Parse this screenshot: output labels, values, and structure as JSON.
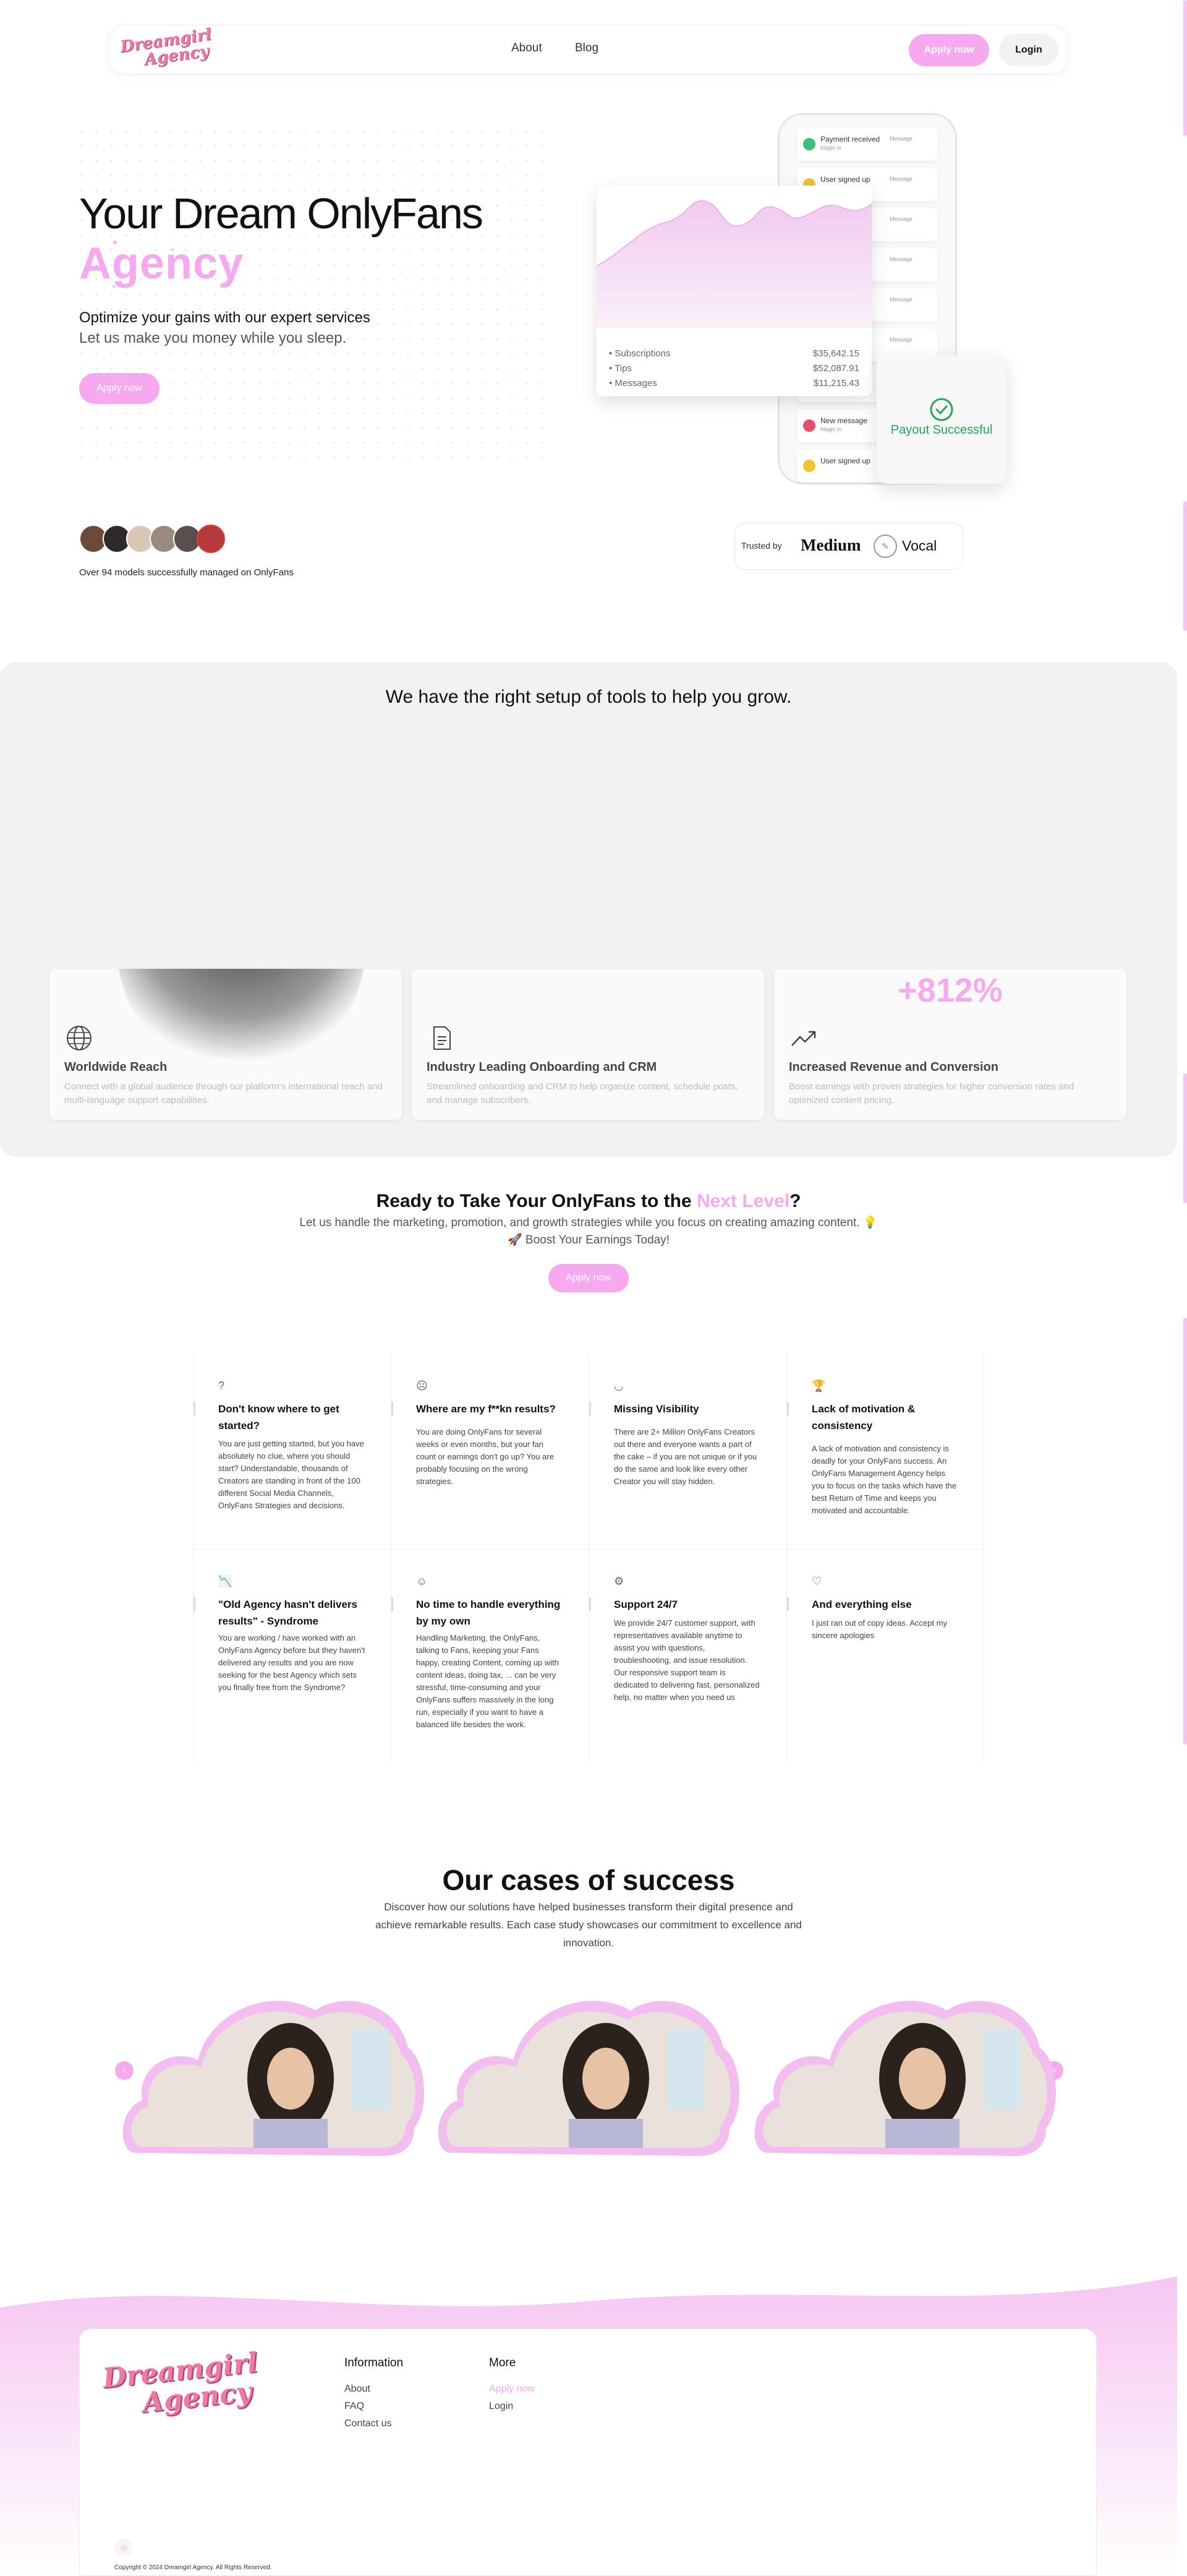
{
  "brand": {
    "logo_line1": "Dreamgirl",
    "logo_line2": "Agency"
  },
  "nav": {
    "about": "About",
    "blog": "Blog",
    "apply": "Apply now",
    "login": "Login"
  },
  "hero": {
    "title_line1": "Your Dream OnlyFans",
    "title_line2": "Agency",
    "subtitle1": "Optimize your gains with our expert services",
    "subtitle2": "Let us make you money while you sleep.",
    "cta": "Apply now"
  },
  "phone": {
    "notifications": [
      {
        "title": "Payment received",
        "sub": "Magic m",
        "meta": "Message",
        "color": "#3ac07a"
      },
      {
        "title": "User signed up",
        "sub": "Magic m",
        "meta": "Message",
        "color": "#f2c230"
      },
      {
        "title": "",
        "sub": "",
        "meta": "Message",
        "color": "#ffffff"
      },
      {
        "title": "",
        "sub": "",
        "meta": "Message",
        "color": "#ffffff"
      },
      {
        "title": "",
        "sub": "",
        "meta": "Message",
        "color": "#ffffff"
      },
      {
        "title": "",
        "sub": "",
        "meta": "Message",
        "color": "#ffffff"
      },
      {
        "title": "",
        "sub": "",
        "meta": "",
        "color": "#ffffff"
      },
      {
        "title": "New message",
        "sub": "Magic m",
        "meta": "Message",
        "color": "#e44d6f"
      },
      {
        "title": "User signed up",
        "sub": "",
        "meta": "",
        "color": "#f2c230"
      }
    ]
  },
  "revenue": {
    "rows": [
      {
        "label": "Subscriptions",
        "value": "$35,642.15"
      },
      {
        "label": "Tips",
        "value": "$52,087.91"
      },
      {
        "label": "Messages",
        "value": "$11,215.43"
      }
    ]
  },
  "payout": {
    "text": "Payout Successful"
  },
  "social_proof": {
    "text": "Over 94 models successfully managed on OnlyFans"
  },
  "trusted": {
    "label": "Trusted by",
    "brand1": "Medium",
    "brand2": "Vocal"
  },
  "tools": {
    "title": "We have the right setup of tools to help you grow.",
    "stat": "+812%",
    "cards": [
      {
        "title": "Worldwide Reach",
        "desc": "Connect with a global audience through our platform's international reach and multi-language support capabilities."
      },
      {
        "title": "Industry Leading Onboarding and CRM",
        "desc": "Streamlined onboarding and CRM to help organize content, schedule posts, and manage subscribers."
      },
      {
        "title": "Increased Revenue and Conversion",
        "desc": "Boost earnings with proven strategies for higher conversion rates and optimized content pricing."
      }
    ]
  },
  "ready": {
    "title_pre": "Ready to Take Your OnlyFans to the ",
    "title_hl": "Next Level",
    "title_post": "?",
    "sub1": "Let us handle the marketing, promotion, and growth strategies while you focus on creating amazing content. 💡",
    "sub2": "🚀 Boost Your Earnings Today!",
    "cta": "Apply now"
  },
  "problems": [
    {
      "icon": "?",
      "title": "Don't know where to get started?",
      "desc": "You are just getting started, but you have absolutely no clue, where you should start? Understandable, thousands of Creators are standing in front of the 100 different Social Media Channels, OnlyFans Strategies and decisions."
    },
    {
      "icon": "☹",
      "title": "Where are my f**kn results?",
      "desc": "You are doing OnlyFans for several weeks or even months, but your fan count or earnings don't go up? You are probably focusing on the wrong strategies."
    },
    {
      "icon": "◡",
      "title": "Missing Visibility",
      "desc": "There are 2+ Million OnlyFans Creators out there and everyone wants a part of the cake – if you are not unique or if you do the same and look like every other Creator you will stay hidden."
    },
    {
      "icon": "🏆",
      "title": "Lack of motivation & consistency",
      "desc": "A lack of motivation and consistency is deadly for your OnlyFans success. An OnlyFans Management Agency helps you to focus on the tasks which have the best Return of Time and keeps you motivated and accountable."
    },
    {
      "icon": "📉",
      "title": "\"Old Agency hasn't delivers results\" - Syndrome",
      "desc": "You are working / have worked with an OnlyFans Agency before but they haven't delivered any results and you are now seeking for the best Agency which sets you finally free from the Syndrome?"
    },
    {
      "icon": "☺",
      "title": "No time to handle everything by my own",
      "desc": "Handling Marketing, the OnlyFans, talking to Fans, keeping your Fans happy, creating Content, coming up with content ideas, doing tax, ... can be very stressful, time-consuming and your OnlyFans suffers massively in the long run, especially if you want to have a balanced life besides the work."
    },
    {
      "icon": "⚙",
      "title": "Support 24/7",
      "desc": "We provide 24/7 customer support, with representatives available anytime to assist you with questions, troubleshooting, and issue resolution. Our responsive support team is dedicated to delivering fast, personalized help, no matter when you need us"
    },
    {
      "icon": "♡",
      "title": "And everything else",
      "desc": "I just ran out of copy ideas. Accept my sincere apologies"
    }
  ],
  "cases": {
    "title": "Our cases of success",
    "subtitle": "Discover how our solutions have helped businesses transform their digital presence and achieve remarkable results. Each case study showcases our commitment to excellence and innovation."
  },
  "footer": {
    "info_title": "Information",
    "info_links": [
      "About",
      "FAQ",
      "Contact us"
    ],
    "more_title": "More",
    "more_apply": "Apply now",
    "more_login": "Login",
    "copyright": "Copyright © 2024 Dreamgirl Agency. All Rights Reserved."
  },
  "colors": {
    "accent": "#f6a9ee",
    "logo": "#ec7aa6",
    "success": "#22a35a"
  }
}
